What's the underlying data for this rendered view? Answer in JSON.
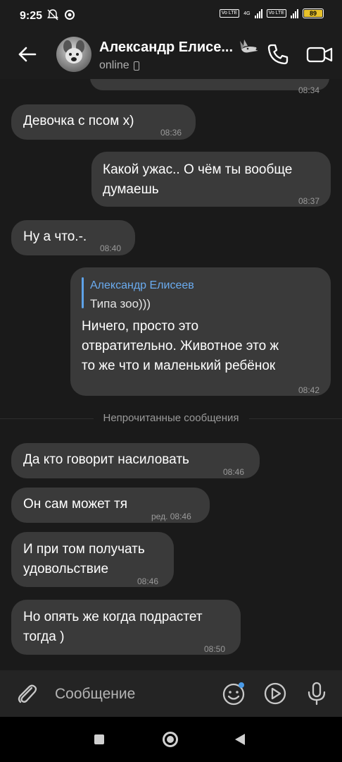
{
  "status_bar": {
    "time": "9:25",
    "lte1": "Vo LTE",
    "lte2": "Vo LTE",
    "net": "4G",
    "battery": "89"
  },
  "header": {
    "name": "Александр Елисе...",
    "status": "online",
    "icons": [
      "back-arrow-icon",
      "wolf-emoji-icon",
      "phone-icon",
      "video-camera-icon"
    ]
  },
  "messages": [
    {
      "dir": "in",
      "text": "Девочка с псом х)",
      "time": "08:36"
    },
    {
      "dir": "out",
      "lines": [
        "Какой ужас.. О чём ты вообще",
        "думаешь"
      ],
      "time": "08:37"
    },
    {
      "dir": "in",
      "text": "Ну а что.-.",
      "time": "08:40"
    },
    {
      "dir": "out",
      "reply_name": "Александр Елисеев",
      "reply_text": "Типа зоо)))",
      "lines": [
        "Ничего, просто это",
        "отвратительно. Животное это ж",
        "то же что и маленький ребёнок"
      ],
      "time": "08:42"
    },
    {
      "dir": "in",
      "text": "Да кто говорит насиловать",
      "time": "08:46"
    },
    {
      "dir": "in",
      "text": "Он сам может тя",
      "time": "ред. 08:46"
    },
    {
      "dir": "in",
      "lines": [
        "И при том получать",
        "удовольствие"
      ],
      "time": "08:46"
    },
    {
      "dir": "in",
      "lines": [
        "Но опять же когда подрастет",
        "тогда )"
      ],
      "time": "08:50"
    }
  ],
  "partial_top_time": "08:34",
  "unread_divider": "Непрочитанные сообщения",
  "input": {
    "placeholder": "Сообщение",
    "icons": [
      "attach-icon",
      "emoji-icon",
      "video-message-icon",
      "microphone-icon"
    ]
  },
  "colors": {
    "background": "#1a1a1a",
    "bubble": "#3a3a3a",
    "reply_accent": "#5ea2e8",
    "battery": "#e8c22a"
  }
}
